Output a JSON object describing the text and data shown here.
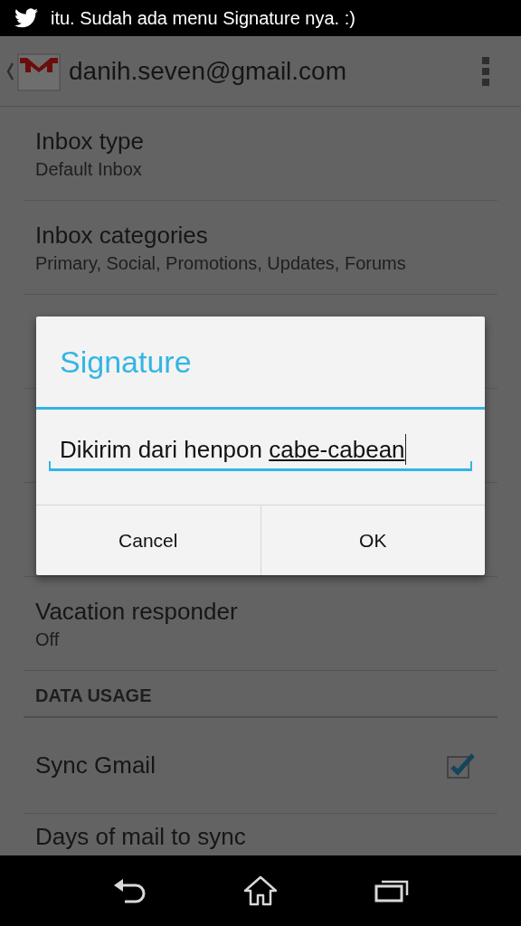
{
  "status_bar": {
    "notification": "itu. Sudah ada menu Signature nya. :)"
  },
  "action_bar": {
    "account": "danih.seven@gmail.com"
  },
  "settings": [
    {
      "kind": "item",
      "title": "Inbox type",
      "summary": "Default Inbox"
    },
    {
      "kind": "item",
      "title": "Inbox categories",
      "summary": "Primary, Social, Promotions, Updates, Forums"
    },
    {
      "kind": "covered"
    },
    {
      "kind": "covered"
    },
    {
      "kind": "covered"
    },
    {
      "kind": "item",
      "title": "Vacation responder",
      "summary": "Off"
    },
    {
      "kind": "header",
      "title": "DATA USAGE"
    },
    {
      "kind": "checkbox",
      "title": "Sync Gmail",
      "checked": true
    },
    {
      "kind": "item",
      "title": "Days of mail to sync"
    }
  ],
  "dialog": {
    "title": "Signature",
    "field": {
      "text": "Dikirim dari henpon",
      "composing": "cabe-cabean"
    },
    "buttons": [
      "Cancel",
      "OK"
    ]
  }
}
